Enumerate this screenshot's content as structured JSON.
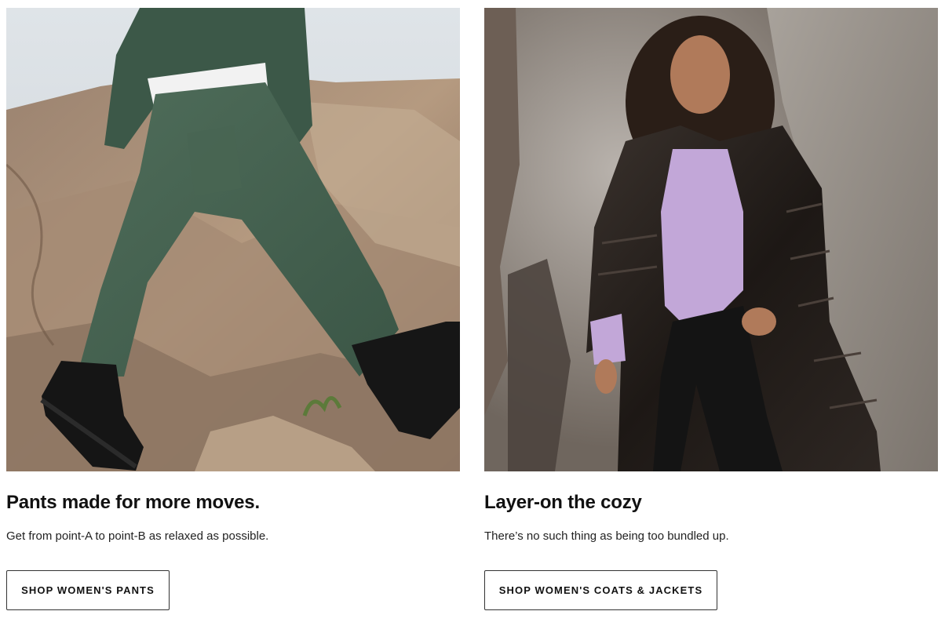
{
  "cards": [
    {
      "image_alt": "Model in green cargo pants and black platform boots stepping over rocks",
      "title": "Pants made for more moves.",
      "description": "Get from point-A to point-B as relaxed as possible.",
      "button_label": "SHOP WOMEN'S PANTS"
    },
    {
      "image_alt": "Model in long black puffer coat and lilac sweater against rocks and smoke",
      "title": "Layer-on the cozy",
      "description": "There’s no such thing as being too bundled up.",
      "button_label": "SHOP WOMEN'S COATS & JACKETS"
    }
  ],
  "colors": {
    "text": "#111111",
    "button_border": "#333333",
    "background": "#ffffff"
  }
}
